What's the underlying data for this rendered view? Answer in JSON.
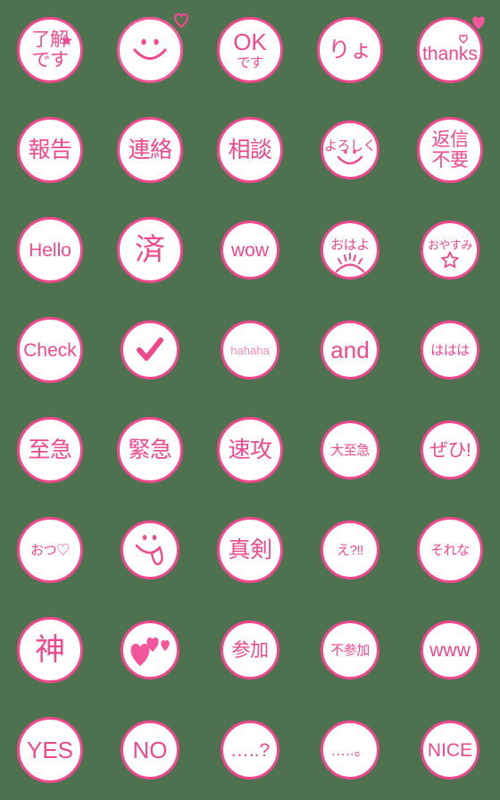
{
  "sheet": {
    "title": "Pink Stamp Emoji Sheet",
    "columns": 5,
    "rows": 8,
    "background_color": "#4e7150",
    "accent_color": "#f0488f",
    "accent_pale_color": "#f78ab8",
    "disc_fill_color": "#ffffff"
  },
  "stickers": [
    {
      "id": "ryoukai-desu",
      "kind": "text2",
      "line1": "了解",
      "line2": "です",
      "decor": "star-icon"
    },
    {
      "id": "smile-heart",
      "kind": "face-smile",
      "label": "",
      "decor": "heart-outline-icon"
    },
    {
      "id": "ok-desu",
      "kind": "text2",
      "line1": "OK",
      "line2": "です",
      "decor": ""
    },
    {
      "id": "ryo",
      "kind": "text1",
      "line1": "りょ",
      "decor": ""
    },
    {
      "id": "thanks",
      "kind": "text1",
      "line1": "thanks",
      "decor": "heart-filled-icon"
    },
    {
      "id": "houkoku",
      "kind": "text1",
      "line1": "報告",
      "decor": ""
    },
    {
      "id": "renraku",
      "kind": "text1",
      "line1": "連絡",
      "decor": ""
    },
    {
      "id": "soudan",
      "kind": "text1",
      "line1": "相談",
      "decor": ""
    },
    {
      "id": "yoroshiku",
      "kind": "text-smile",
      "line1": "よろしく",
      "decor": "smile-icon"
    },
    {
      "id": "henshin-fuyou",
      "kind": "text2",
      "line1": "返信",
      "line2": "不要",
      "decor": ""
    },
    {
      "id": "hello",
      "kind": "text1",
      "line1": "Hello",
      "decor": ""
    },
    {
      "id": "sumi",
      "kind": "text1",
      "line1": "済",
      "decor": ""
    },
    {
      "id": "wow",
      "kind": "text1",
      "line1": "wow",
      "decor": ""
    },
    {
      "id": "ohayo",
      "kind": "text-sunrise",
      "line1": "おはよ",
      "decor": "sunrise-icon"
    },
    {
      "id": "oyasumi",
      "kind": "text-star",
      "line1": "おやすみ",
      "decor": "star-outline-icon"
    },
    {
      "id": "check",
      "kind": "text1",
      "line1": "Check",
      "decor": ""
    },
    {
      "id": "checkmark",
      "kind": "checkmark",
      "line1": "",
      "decor": "check-icon"
    },
    {
      "id": "hahaha",
      "kind": "text1",
      "line1": "hahaha",
      "decor": ""
    },
    {
      "id": "and",
      "kind": "text1",
      "line1": "and",
      "decor": ""
    },
    {
      "id": "hahaha-jp",
      "kind": "text1",
      "line1": "ははは",
      "decor": ""
    },
    {
      "id": "shikyuu",
      "kind": "text1",
      "line1": "至急",
      "decor": ""
    },
    {
      "id": "kinkyuu",
      "kind": "text1",
      "line1": "緊急",
      "decor": ""
    },
    {
      "id": "sokkou",
      "kind": "text1",
      "line1": "速攻",
      "decor": ""
    },
    {
      "id": "dai-shikyuu",
      "kind": "text1",
      "line1": "大至急",
      "decor": ""
    },
    {
      "id": "zehi",
      "kind": "text1",
      "line1": "ぜひ!",
      "decor": ""
    },
    {
      "id": "otsu-heart",
      "kind": "text1",
      "line1": "おつ♡",
      "decor": ""
    },
    {
      "id": "tongue-face",
      "kind": "face-tongue",
      "line1": "",
      "decor": "tongue-icon"
    },
    {
      "id": "shinken",
      "kind": "text1",
      "line1": "真剣",
      "decor": ""
    },
    {
      "id": "eh",
      "kind": "text1",
      "line1": "え?!!",
      "decor": ""
    },
    {
      "id": "sorena",
      "kind": "text1",
      "line1": "それな",
      "decor": ""
    },
    {
      "id": "kami",
      "kind": "text1",
      "line1": "神",
      "decor": ""
    },
    {
      "id": "hearts",
      "kind": "hearts",
      "line1": "",
      "decor": "hearts-icon"
    },
    {
      "id": "sanka",
      "kind": "text1",
      "line1": "参加",
      "decor": ""
    },
    {
      "id": "fusanka",
      "kind": "text1",
      "line1": "不参加",
      "decor": ""
    },
    {
      "id": "www",
      "kind": "text1",
      "line1": "www",
      "decor": ""
    },
    {
      "id": "yes",
      "kind": "text1",
      "line1": "YES",
      "decor": ""
    },
    {
      "id": "no",
      "kind": "text1",
      "line1": "NO",
      "decor": ""
    },
    {
      "id": "dots-question",
      "kind": "dots-q",
      "line1": "…..?",
      "decor": "question-icon"
    },
    {
      "id": "dots-maru",
      "kind": "dots-o",
      "line1": "…..。",
      "decor": "circle-icon"
    },
    {
      "id": "nice",
      "kind": "text1",
      "line1": "NICE",
      "decor": ""
    }
  ]
}
